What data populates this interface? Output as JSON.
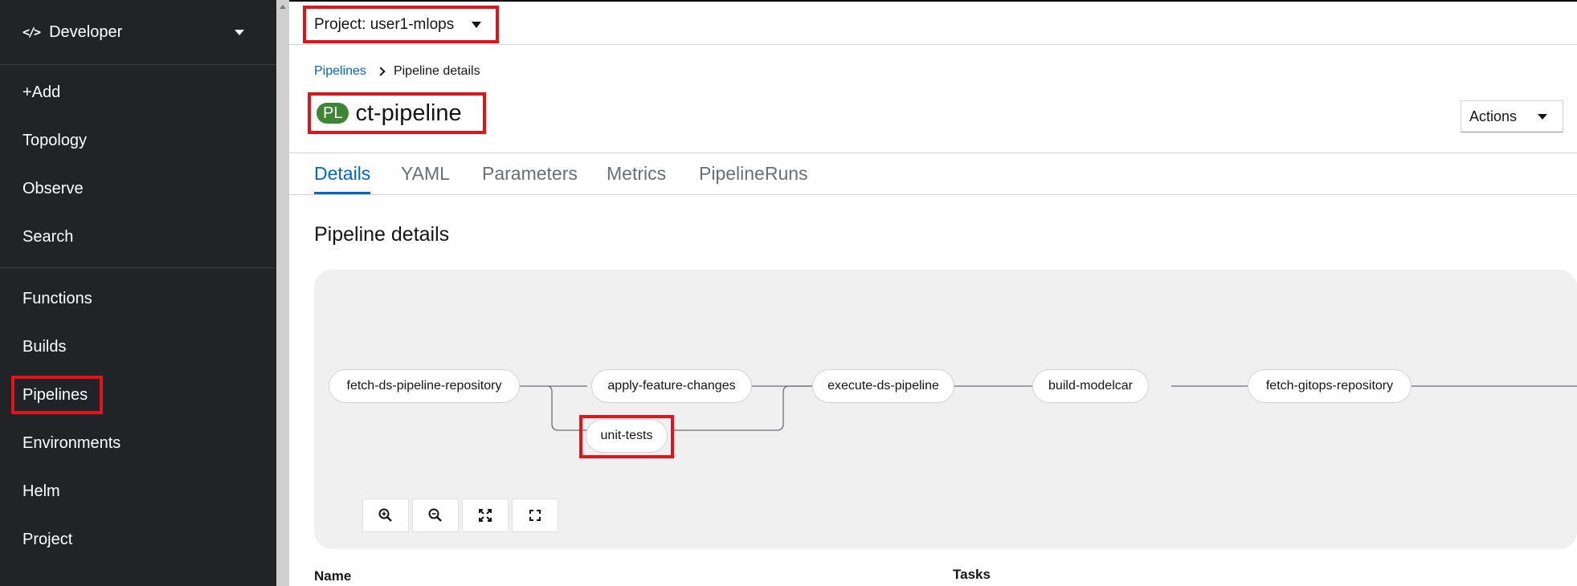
{
  "sidebar": {
    "perspective": {
      "icon": "code-icon",
      "label": "Developer"
    },
    "group1": [
      "+Add",
      "Topology",
      "Observe",
      "Search"
    ],
    "group2": [
      "Functions",
      "Builds",
      "Pipelines",
      "Environments",
      "Helm",
      "Project"
    ],
    "active": "Pipelines"
  },
  "header": {
    "project_label": "Project: user1-mlops"
  },
  "breadcrumb": {
    "link": "Pipelines",
    "current": "Pipeline details"
  },
  "page": {
    "badge": "PL",
    "title": "ct-pipeline",
    "actions_label": "Actions"
  },
  "tabs": [
    "Details",
    "YAML",
    "Parameters",
    "Metrics",
    "PipelineRuns"
  ],
  "active_tab": "Details",
  "section_title": "Pipeline details",
  "pipeline": {
    "tasks": [
      "fetch-ds-pipeline-repository",
      "apply-feature-changes",
      "unit-tests",
      "execute-ds-pipeline",
      "build-modelcar",
      "fetch-gitops-repository"
    ],
    "highlighted_task": "unit-tests"
  },
  "zoom_controls": [
    "zoom-in-icon",
    "zoom-out-icon",
    "fit-to-screen-icon",
    "expand-icon"
  ],
  "table": {
    "col_name": "Name",
    "col_tasks": "Tasks"
  },
  "colors": {
    "sidebar_bg": "#212427",
    "highlight": "#e3131b",
    "link": "#0066cc",
    "badge": "#3e8635"
  }
}
